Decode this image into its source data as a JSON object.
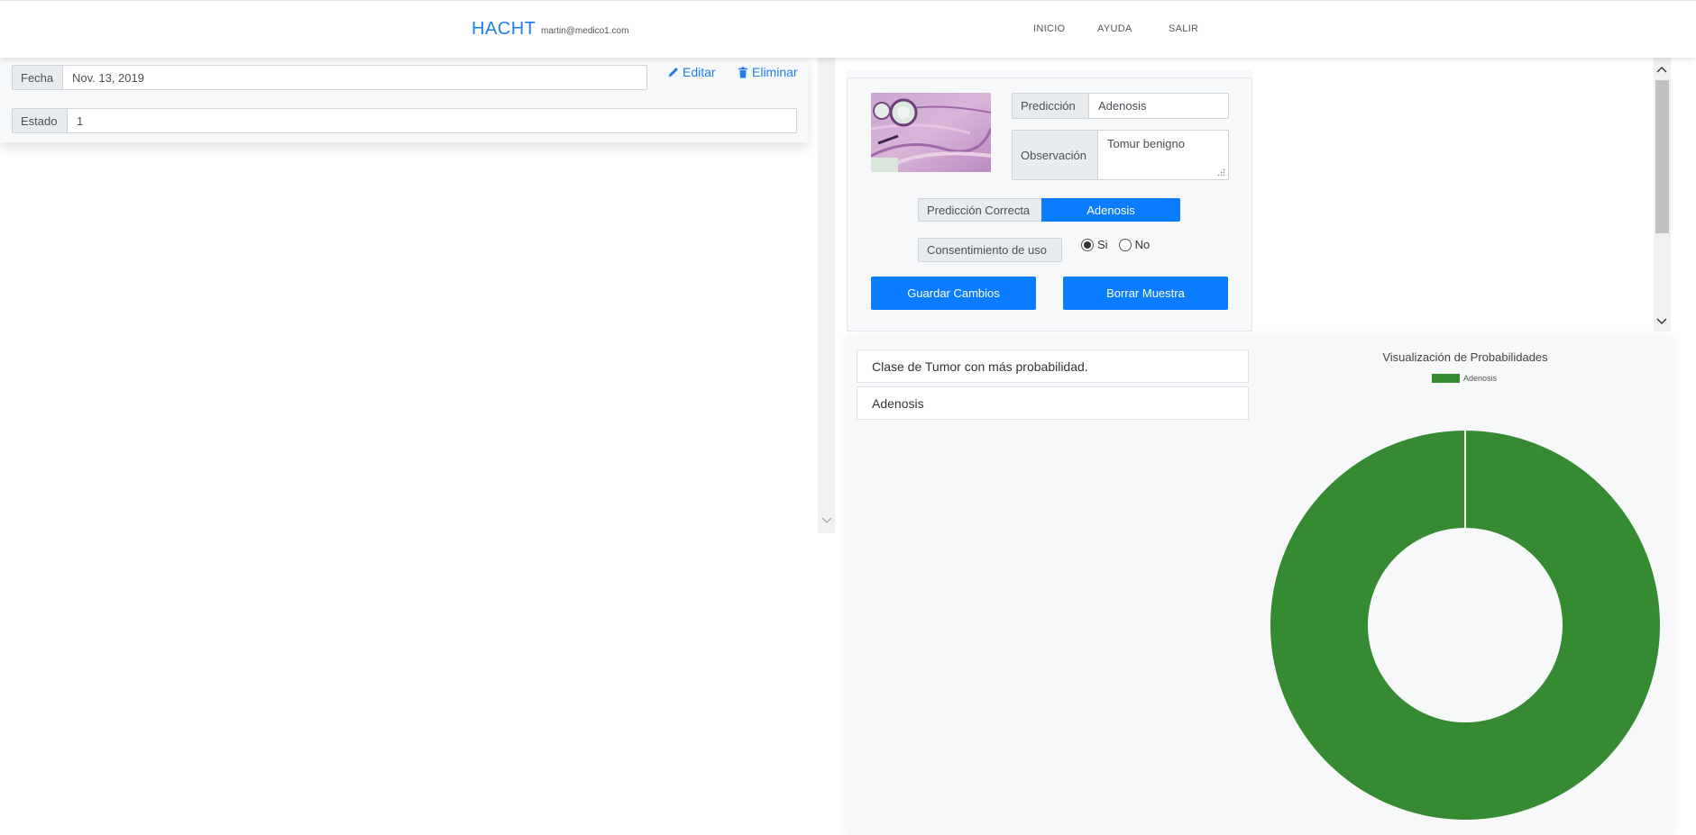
{
  "navbar": {
    "brand": "HACHT",
    "user_email": "martin@medico1.com",
    "links": [
      "INICIO",
      "AYUDA",
      "SALIR"
    ]
  },
  "record": {
    "fecha_label": "Fecha",
    "fecha_value": "Nov. 13, 2019",
    "estado_label": "Estado",
    "estado_value": "1",
    "edit_label": "Editar",
    "delete_label": "Eliminar"
  },
  "sample": {
    "prediccion_label": "Predicción",
    "prediccion_value": "Adenosis",
    "observacion_label": "Observación",
    "observacion_value": "Tomur benigno",
    "prediccion_correcta_label": "Predicción Correcta",
    "prediccion_correcta_value": "Adenosis",
    "consentimiento_label": "Consentimiento de uso",
    "consent_options": [
      {
        "label": "Si",
        "checked": true
      },
      {
        "label": "No",
        "checked": false
      }
    ],
    "save_button": "Guardar Cambios",
    "delete_button": "Borrar Muestra"
  },
  "results": {
    "class_heading": "Clase de Tumor con más probabilidad.",
    "class_value": "Adenosis"
  },
  "chart_data": {
    "type": "pie",
    "title": "Visualización de Probabilidades",
    "categories": [
      "Adenosis"
    ],
    "values": [
      100
    ],
    "colors": [
      "#368a31"
    ],
    "donut": true,
    "legend_position": "top"
  },
  "icons": {
    "edit": "pencil-icon",
    "delete": "trash-icon",
    "resize": "resize-grip-icon",
    "scroll_up": "chevron-up-icon",
    "scroll_down": "chevron-down-icon"
  }
}
